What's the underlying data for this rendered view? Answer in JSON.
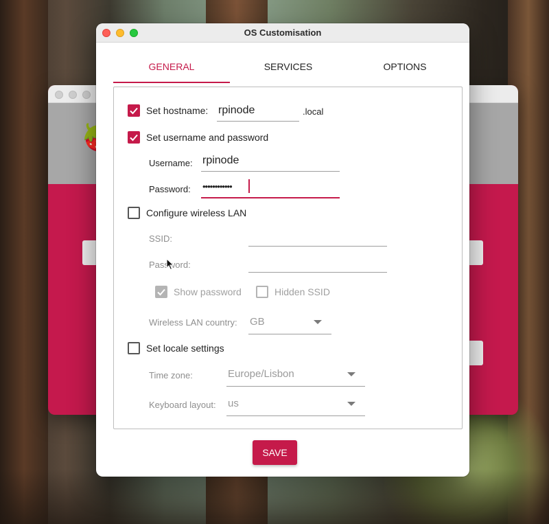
{
  "dialog": {
    "title": "OS Customisation",
    "tabs": [
      {
        "label": "GENERAL",
        "active": true
      },
      {
        "label": "SERVICES",
        "active": false
      },
      {
        "label": "OPTIONS",
        "active": false
      }
    ],
    "hostname": {
      "checkbox_label": "Set hostname:",
      "checked": true,
      "value": "rpinode",
      "suffix": ".local"
    },
    "user": {
      "checkbox_label": "Set username and password",
      "checked": true,
      "username_label": "Username:",
      "username_value": "rpinode",
      "password_label": "Password:",
      "password_value": "••••••••••••"
    },
    "wlan": {
      "checkbox_label": "Configure wireless LAN",
      "checked": false,
      "ssid_label": "SSID:",
      "ssid_value": "",
      "password_label": "Password:",
      "password_value": "",
      "show_password_label": "Show password",
      "show_password_checked": true,
      "hidden_ssid_label": "Hidden SSID",
      "hidden_ssid_checked": false,
      "country_label": "Wireless LAN country:",
      "country_value": "GB"
    },
    "locale": {
      "checkbox_label": "Set locale settings",
      "checked": false,
      "timezone_label": "Time zone:",
      "timezone_value": "Europe/Lisbon",
      "keyboard_label": "Keyboard layout:",
      "keyboard_value": "us"
    },
    "save_label": "SAVE"
  },
  "colors": {
    "accent": "#c51a4a",
    "back_window": "#c5194d"
  }
}
